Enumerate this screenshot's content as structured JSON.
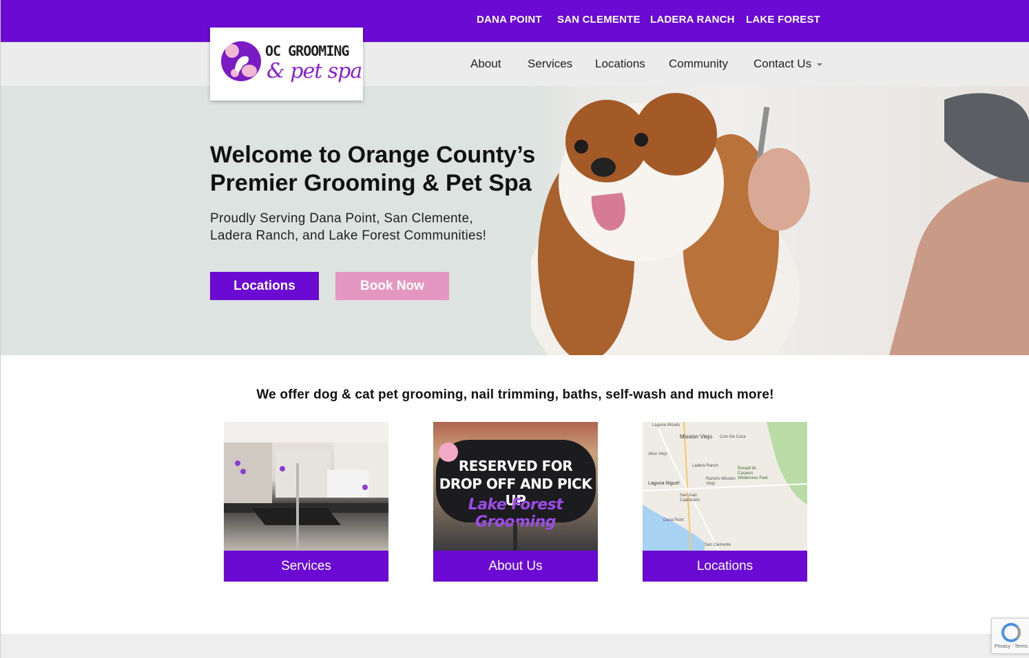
{
  "top_locations": [
    "DANA POINT",
    "SAN CLEMENTE",
    "LADERA RANCH",
    "LAKE FOREST"
  ],
  "logo": {
    "title": "OC GROOMING",
    "script": "& pet spa"
  },
  "nav": {
    "items": [
      "About",
      "Services",
      "Locations",
      "Community",
      "Contact Us"
    ]
  },
  "hero": {
    "title_line1": "Welcome to Orange County’s",
    "title_line2": "Premier Grooming & Pet Spa",
    "subtitle_line1": "Proudly Serving Dana Point, San Clemente,",
    "subtitle_line2": "Ladera Ranch, and Lake Forest Communities!",
    "btn_locations": "Locations",
    "btn_book": "Book Now"
  },
  "offer": "We offer dog & cat pet grooming, nail trimming, baths, self-wash and much more!",
  "cards": [
    {
      "label": "Services"
    },
    {
      "label": "About Us",
      "sign": [
        "RESERVED FOR",
        "DROP OFF AND PICK UP",
        "Lake Forest Grooming"
      ]
    },
    {
      "label": "Locations",
      "map_labels": [
        "Laguna Woods",
        "Mission Viejo",
        "Coto De Caza",
        "Aliso Viejo",
        "Ladera Ranch",
        "Ronald W. Caspers Wilderness Park",
        "Laguna Niguel",
        "Rancho Mission Viejo",
        "San Juan Capistrano",
        "Dana Point",
        "San Clemente"
      ]
    }
  ],
  "recaptcha": {
    "text": "Privacy - Terms"
  },
  "colors": {
    "primary": "#6b0ad3",
    "pink": "#e497c0",
    "hero_bg": "#dde3e0",
    "nav_bg": "#ececec"
  }
}
